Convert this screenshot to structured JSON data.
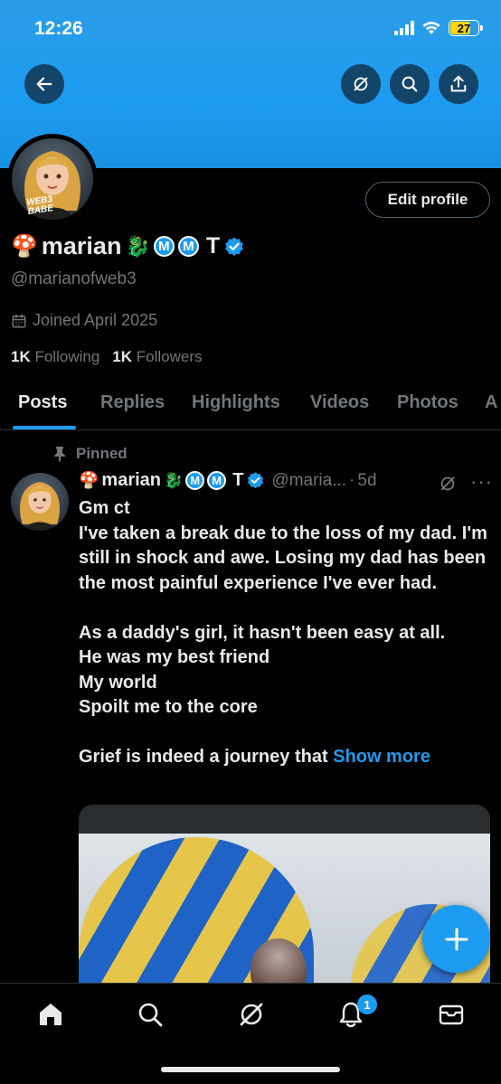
{
  "status_bar": {
    "time": "12:26",
    "battery": "27"
  },
  "header": {
    "back_icon": "arrow-left-icon",
    "grok_icon": "grok-icon",
    "search_icon": "search-icon",
    "share_icon": "share-icon"
  },
  "profile": {
    "avatar_text": "WEB3 BABE",
    "edit_label": "Edit profile",
    "name_emoji": "🍄",
    "name": "marian",
    "name_emoji2": "🐉",
    "badge_1": "M",
    "badge_2": "M",
    "name_suffix": "T",
    "handle": "@marianofweb3",
    "joined": "Joined April 2025",
    "following_count": "1K",
    "following_label": "Following",
    "followers_count": "1K",
    "followers_label": "Followers"
  },
  "tabs": [
    {
      "label": "Posts",
      "active": true
    },
    {
      "label": "Replies"
    },
    {
      "label": "Highlights"
    },
    {
      "label": "Videos"
    },
    {
      "label": "Photos"
    },
    {
      "label": "A"
    }
  ],
  "post": {
    "pinned_label": "Pinned",
    "name": "marian",
    "badge_1": "M",
    "badge_2": "M",
    "name_suffix": "T",
    "handle": "@maria...",
    "dot": "·",
    "time": "5d",
    "more": "···",
    "body": "Gm ct\nI've taken a break due to the loss of my dad. I'm still in shock and awe. Losing my dad has been the most painful experience I've ever had.\n\nAs a daddy's girl, it hasn't been easy at all.\nHe was my best friend\nMy world\nSpoilt me to the core\n\nGrief is indeed a journey that ",
    "show_more": "Show more"
  },
  "colors": {
    "accent": "#1d9bf0",
    "background": "#000000",
    "muted": "#71767b",
    "text": "#e7e9ea"
  },
  "nav": {
    "home_icon": "home-icon",
    "search_icon": "search-icon",
    "grok_icon": "grok-icon",
    "notifications_icon": "bell-icon",
    "notifications_count": "1",
    "messages_icon": "mail-icon"
  }
}
